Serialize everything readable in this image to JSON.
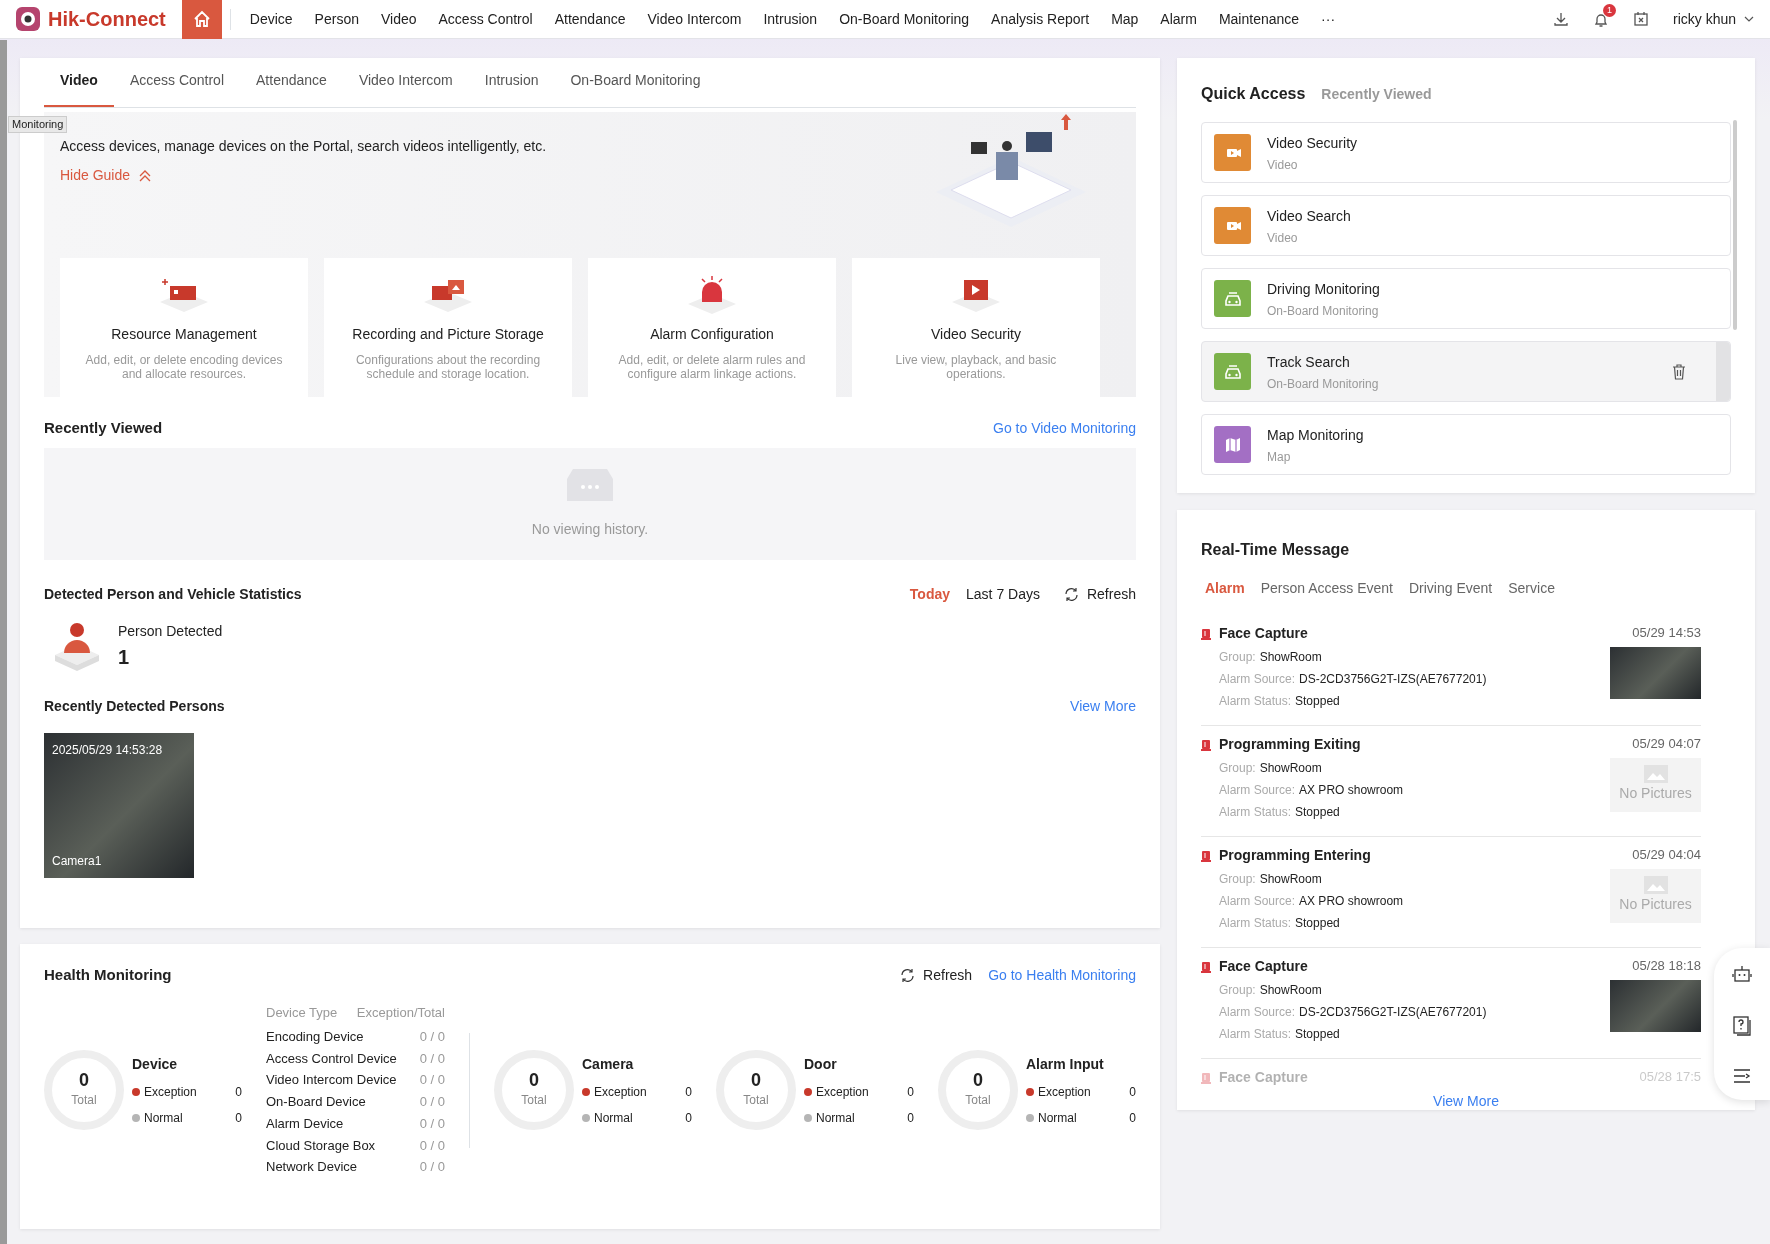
{
  "app": {
    "logo": "Hik-Connect",
    "home": {
      "selected": true
    },
    "nav": [
      {
        "label": "Device",
        "selected": false
      },
      {
        "label": "Person",
        "selected": false
      },
      {
        "label": "Video",
        "selected": false
      },
      {
        "label": "Access Control",
        "selected": false
      },
      {
        "label": "Attendance",
        "selected": false
      },
      {
        "label": "Video Intercom",
        "selected": false
      },
      {
        "label": "Intrusion",
        "selected": false
      },
      {
        "label": "On-Board Monitoring",
        "selected": false
      },
      {
        "label": "Analysis Report",
        "selected": false
      },
      {
        "label": "Map",
        "selected": false
      },
      {
        "label": "Alarm",
        "selected": false
      },
      {
        "label": "Maintenance",
        "selected": false
      },
      {
        "label": "···",
        "selected": false
      }
    ],
    "notification_count": "1",
    "user": "ricky khun"
  },
  "tooltip": "Monitoring",
  "main_tabs": [
    {
      "label": "Video",
      "selected": true
    },
    {
      "label": "Access Control",
      "selected": false
    },
    {
      "label": "Attendance",
      "selected": false
    },
    {
      "label": "Video Intercom",
      "selected": false
    },
    {
      "label": "Intrusion",
      "selected": false
    },
    {
      "label": "On-Board Monitoring",
      "selected": false
    }
  ],
  "guide": {
    "description": "Access devices, manage devices on the Portal, search videos intelligently, etc.",
    "hide_label": "Hide Guide",
    "cards": [
      {
        "kind": "resource",
        "title": "Resource Management",
        "description": "Add, edit, or delete encoding devices and allocate resources."
      },
      {
        "kind": "recording",
        "title": "Recording and Picture Storage",
        "description": "Configurations about the recording schedule and storage location."
      },
      {
        "kind": "alarm",
        "title": "Alarm Configuration",
        "description": "Add, edit, or delete alarm rules and configure alarm linkage actions."
      },
      {
        "kind": "video",
        "title": "Video Security",
        "description": "Live view, playback, and basic operations."
      }
    ]
  },
  "recently_viewed": {
    "title": "Recently Viewed",
    "link": "Go to Video Monitoring",
    "empty_text": "No viewing history."
  },
  "statistics": {
    "title": "Detected Person and Vehicle Statistics",
    "periods": [
      {
        "label": "Today",
        "selected": true
      },
      {
        "label": "Last 7 Days",
        "selected": false
      }
    ],
    "refresh": "Refresh",
    "metric": {
      "label": "Person Detected",
      "value": "1"
    }
  },
  "recent_persons": {
    "title": "Recently Detected Persons",
    "link": "View More",
    "items": [
      {
        "timestamp": "2025/05/29 14:53:28",
        "camera": "Camera1"
      }
    ]
  },
  "health": {
    "title": "Health Monitoring",
    "refresh": "Refresh",
    "link": "Go to Health Monitoring",
    "device": {
      "name": "Device",
      "total": "0",
      "total_label": "Total",
      "rows": [
        {
          "label": "Exception",
          "value": "0",
          "color": "#c8392b"
        },
        {
          "label": "Normal",
          "value": "0",
          "color": "#b5b5b5"
        }
      ]
    },
    "table": {
      "columns": [
        "Device Type",
        "Exception/Total"
      ],
      "rows": [
        [
          "Encoding Device",
          "0 / 0"
        ],
        [
          "Access Control Device",
          "0 / 0"
        ],
        [
          "Video Intercom Device",
          "0 / 0"
        ],
        [
          "On-Board Device",
          "0 / 0"
        ],
        [
          "Alarm Device",
          "0 / 0"
        ],
        [
          "Cloud Storage Box",
          "0 / 0"
        ],
        [
          "Network Device",
          "0 / 0"
        ]
      ]
    },
    "summaries": [
      {
        "name": "Camera",
        "total": "0",
        "total_label": "Total",
        "rows": [
          {
            "label": "Exception",
            "value": "0",
            "color": "#c8392b"
          },
          {
            "label": "Normal",
            "value": "0",
            "color": "#b5b5b5"
          }
        ]
      },
      {
        "name": "Door",
        "total": "0",
        "total_label": "Total",
        "rows": [
          {
            "label": "Exception",
            "value": "0",
            "color": "#c8392b"
          },
          {
            "label": "Normal",
            "value": "0",
            "color": "#b5b5b5"
          }
        ]
      },
      {
        "name": "Alarm Input",
        "total": "0",
        "total_label": "Total",
        "rows": [
          {
            "label": "Exception",
            "value": "0",
            "color": "#c8392b"
          },
          {
            "label": "Normal",
            "value": "0",
            "color": "#b5b5b5"
          }
        ]
      }
    ]
  },
  "quick_access": {
    "tabs": [
      {
        "label": "Quick Access",
        "selected": true
      },
      {
        "label": "Recently Viewed",
        "selected": false
      }
    ],
    "items": [
      {
        "kind": "video",
        "title": "Video Security",
        "category": "Video",
        "color": "#e08a35",
        "hovered": false
      },
      {
        "kind": "video",
        "title": "Video Search",
        "category": "Video",
        "color": "#e08a35",
        "hovered": false
      },
      {
        "kind": "vehicle",
        "title": "Driving Monitoring",
        "category": "On-Board Monitoring",
        "color": "#7cb24a",
        "hovered": false
      },
      {
        "kind": "vehicle",
        "title": "Track Search",
        "category": "On-Board Monitoring",
        "color": "#7cb24a",
        "hovered": true
      },
      {
        "kind": "map",
        "title": "Map Monitoring",
        "category": "Map",
        "color": "#a36fc4",
        "hovered": false
      }
    ]
  },
  "messages": {
    "title": "Real-Time Message",
    "tabs": [
      {
        "label": "Alarm",
        "selected": true
      },
      {
        "label": "Person Access Event",
        "selected": false
      },
      {
        "label": "Driving Event",
        "selected": false
      },
      {
        "label": "Service",
        "selected": false
      }
    ],
    "items": [
      {
        "title": "Face Capture",
        "time": "05/29 14:53",
        "faded": false,
        "has_photo": true,
        "fields": [
          {
            "label": "Group:",
            "value": "ShowRoom"
          },
          {
            "label": "Alarm Source:",
            "value": "DS-2CD3756G2T-IZS(AE7677201)"
          },
          {
            "label": "Alarm Status:",
            "value": "Stopped"
          }
        ]
      },
      {
        "title": "Programming Exiting",
        "time": "05/29 04:07",
        "faded": false,
        "has_photo": false,
        "no_picture": "No Pictures",
        "fields": [
          {
            "label": "Group:",
            "value": "ShowRoom"
          },
          {
            "label": "Alarm Source:",
            "value": "AX PRO showroom"
          },
          {
            "label": "Alarm Status:",
            "value": "Stopped"
          }
        ]
      },
      {
        "title": "Programming Entering",
        "time": "05/29 04:04",
        "faded": false,
        "has_photo": false,
        "no_picture": "No Pictures",
        "fields": [
          {
            "label": "Group:",
            "value": "ShowRoom"
          },
          {
            "label": "Alarm Source:",
            "value": "AX PRO showroom"
          },
          {
            "label": "Alarm Status:",
            "value": "Stopped"
          }
        ]
      },
      {
        "title": "Face Capture",
        "time": "05/28 18:18",
        "faded": false,
        "has_photo": true,
        "fields": [
          {
            "label": "Group:",
            "value": "ShowRoom"
          },
          {
            "label": "Alarm Source:",
            "value": "DS-2CD3756G2T-IZS(AE7677201)"
          },
          {
            "label": "Alarm Status:",
            "value": "Stopped"
          }
        ]
      },
      {
        "title": "Face Capture",
        "time": "05/28 17:5",
        "faded": true,
        "has_photo": false
      }
    ],
    "link": "View More"
  }
}
